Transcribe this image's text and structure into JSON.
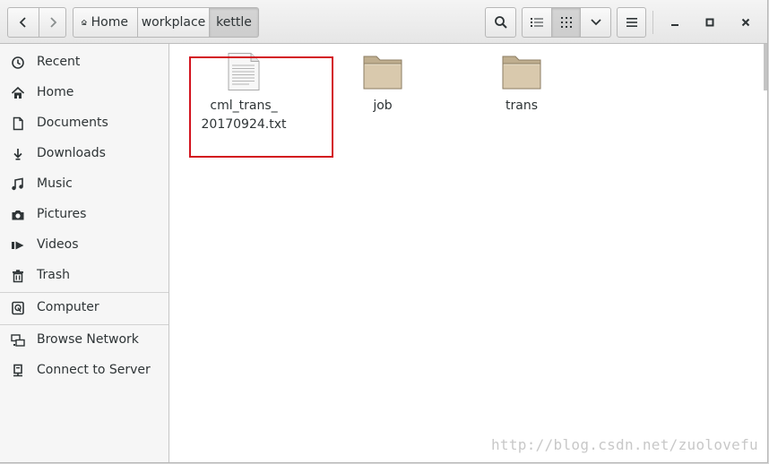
{
  "breadcrumb": {
    "home": "Home",
    "workplace": "workplace",
    "kettle": "kettle"
  },
  "sidebar": {
    "items": [
      {
        "label": "Recent",
        "icon": "recent-icon"
      },
      {
        "label": "Home",
        "icon": "home-icon"
      },
      {
        "label": "Documents",
        "icon": "documents-icon"
      },
      {
        "label": "Downloads",
        "icon": "downloads-icon"
      },
      {
        "label": "Music",
        "icon": "music-icon"
      },
      {
        "label": "Pictures",
        "icon": "pictures-icon"
      },
      {
        "label": "Videos",
        "icon": "videos-icon"
      },
      {
        "label": "Trash",
        "icon": "trash-icon"
      }
    ],
    "devices": [
      {
        "label": "Computer",
        "icon": "computer-icon"
      }
    ],
    "network": [
      {
        "label": "Browse Network",
        "icon": "network-icon"
      },
      {
        "label": "Connect to Server",
        "icon": "server-icon"
      }
    ]
  },
  "files": [
    {
      "line1": "cml_trans_",
      "line2": "20170924.txt",
      "type": "text-file"
    },
    {
      "line1": "job",
      "type": "folder"
    },
    {
      "line1": "trans",
      "type": "folder"
    }
  ],
  "colors": {
    "highlight": "#d3141f",
    "folder": "#d9c9ad"
  },
  "watermark": "http://blog.csdn.net/zuolovefu"
}
